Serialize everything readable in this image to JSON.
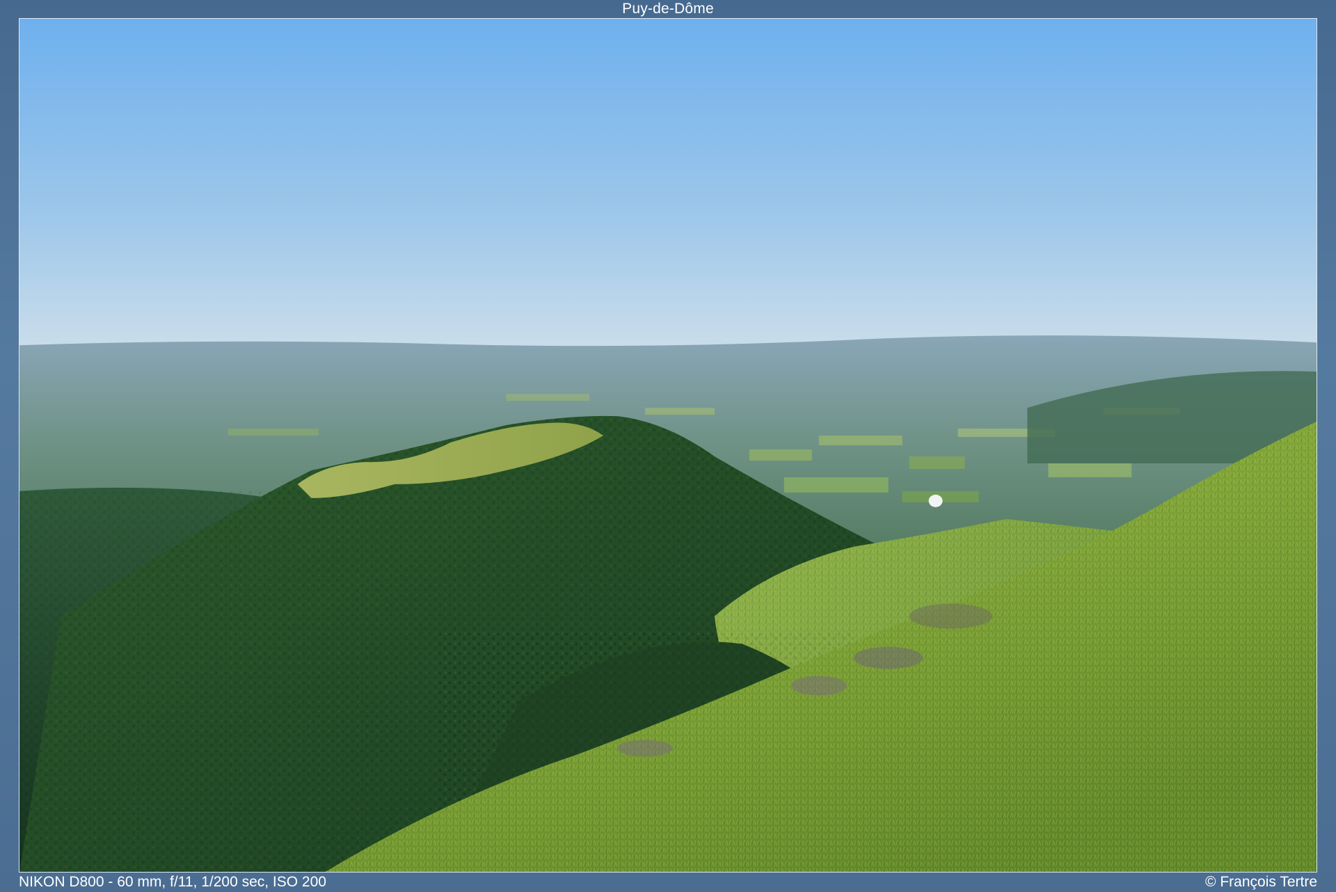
{
  "title": "Puy-de-Dôme",
  "exif": "NIKON D800 - 60 mm, f/11, 1/200 sec, ISO 200",
  "copyright": "© François Tertre",
  "colors": {
    "frame": "#4f6f93",
    "sky_top": "#6fb0ee",
    "sky_horizon": "#cfe0ea",
    "forest": "#1f4526",
    "meadow": "#7fa93c"
  }
}
